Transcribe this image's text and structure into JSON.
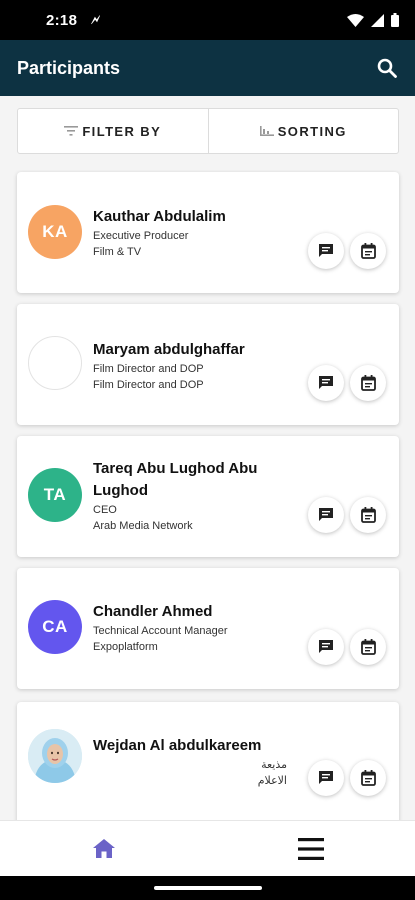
{
  "status_bar": {
    "time": "2:18",
    "notifications": [
      "ǿ",
      "ǿ",
      "ǿ"
    ]
  },
  "app_bar": {
    "title": "Participants",
    "search_icon": "search-icon"
  },
  "filter_bar": {
    "filter_label": "FILTER BY",
    "sorting_label": "SORTING"
  },
  "participants": [
    {
      "initials": "KA",
      "avatar_color": "#f7a463",
      "name": "Kauthar Abdulalim",
      "line1": "Executive Producer",
      "line2": "Film & TV"
    },
    {
      "initials": "",
      "avatar_color": "#ffffff",
      "name": "Maryam abdulghaffar",
      "line1": "Film Director and DOP",
      "line2": "Film Director and DOP"
    },
    {
      "initials": "TA",
      "avatar_color": "#2db389",
      "name": "Tareq Abu Lughod Abu Lughod",
      "line1": "CEO",
      "line2": "Arab Media Network"
    },
    {
      "initials": "CA",
      "avatar_color": "#6356ee",
      "name": "Chandler Ahmed",
      "line1": "Technical Account Manager",
      "line2": "Expoplatform"
    },
    {
      "initials": "",
      "avatar_color": "#cfe6f0",
      "name": "Wejdan Al abdulkareem",
      "line1": "مذيعة",
      "line2": "الاعلام"
    }
  ],
  "bottom_nav": {
    "home_icon": "home-icon",
    "menu_icon": "menu-icon"
  },
  "colors": {
    "app_bar": "#0d3242",
    "home_active": "#6b63c7"
  }
}
